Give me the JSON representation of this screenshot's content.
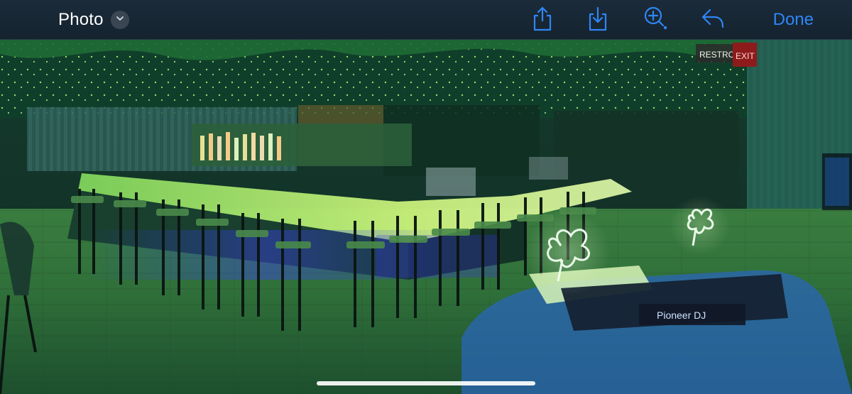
{
  "header": {
    "title": "Photo",
    "title_menu_icon": "chevron-down-icon",
    "actions": [
      {
        "name": "share",
        "icon": "share-icon"
      },
      {
        "name": "download",
        "icon": "download-icon"
      },
      {
        "name": "zoom",
        "icon": "zoom-in-icon"
      },
      {
        "name": "reply",
        "icon": "reply-icon"
      }
    ],
    "done_label": "Done",
    "accent_color": "#2f86f6"
  },
  "image": {
    "exit_sign_text": "EXIT",
    "restroom_sign_text": "RESTRO",
    "dj_brand_text": "Pioneer DJ"
  }
}
